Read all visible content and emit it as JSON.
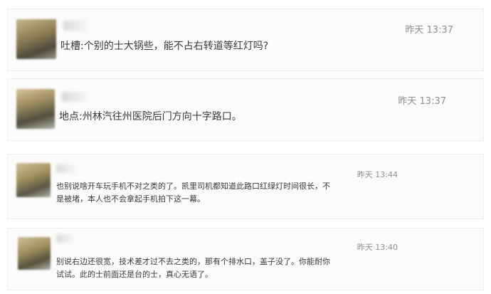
{
  "comments": [
    {
      "time": "昨天 13:37",
      "text": "吐槽:个别的士大锅些，能不占右转道等红灯吗?"
    },
    {
      "time": "昨天 13:37",
      "text": "地点:州林汽往州医院后门方向十字路口。"
    },
    {
      "time": "昨天 13:44",
      "lines": [
        "也别说啥开车玩手机不对之类的了。凯里司机都知道此路口红绿灯时间很长，不",
        "是被堵，本人也不会拿起手机拍下这一幕。"
      ]
    },
    {
      "time": "昨天 13:40",
      "lines": [
        "别说右边还很宽，技术差才过不去之类的，那有个排水口，盖子没了。你能耐你",
        "试试。此的士前面还是台的士，真心无语了。"
      ]
    }
  ],
  "colors": {
    "text": "#3a3a3a",
    "time": "#8f8f8f",
    "card_bg": "#fbfbfb",
    "border": "#eeeeee"
  }
}
